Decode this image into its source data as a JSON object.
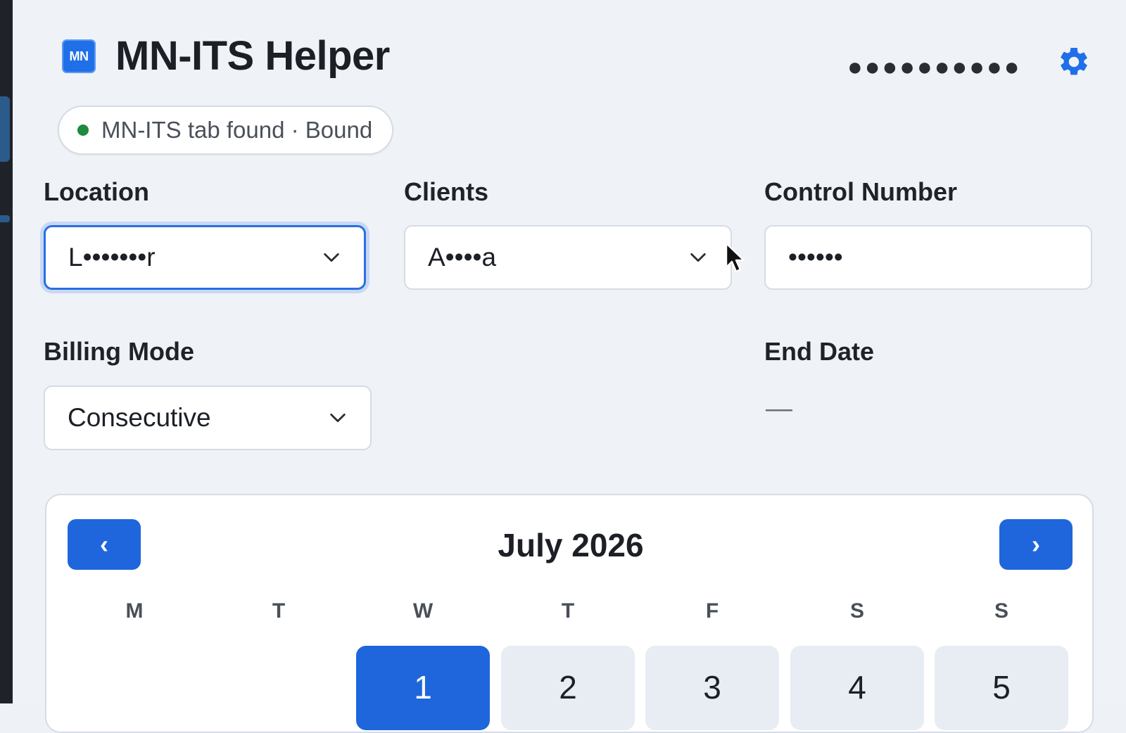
{
  "header": {
    "logo_text": "MN",
    "title": "MN-ITS Helper",
    "masked_account": "●●●●●●●●●●",
    "settings_icon": "gear-icon",
    "accent_color": "#1f66dd"
  },
  "status": {
    "text": "MN-ITS tab found · Bound",
    "dot_color": "#1e8a3c"
  },
  "fields": {
    "location": {
      "label": "Location",
      "value": "L•••••••r"
    },
    "clients": {
      "label": "Clients",
      "value": "A••••a"
    },
    "control_number": {
      "label": "Control Number",
      "value": "••••••"
    },
    "billing_mode": {
      "label": "Billing Mode",
      "value": "Consecutive"
    },
    "end_date": {
      "label": "End Date",
      "value": "—"
    }
  },
  "calendar": {
    "prev_label": "‹",
    "next_label": "›",
    "month_title": "July 2026",
    "weekdays": [
      "M",
      "T",
      "W",
      "T",
      "F",
      "S",
      "S"
    ],
    "days": [
      "1",
      "2",
      "3",
      "4",
      "5"
    ],
    "selected_day": "1"
  }
}
